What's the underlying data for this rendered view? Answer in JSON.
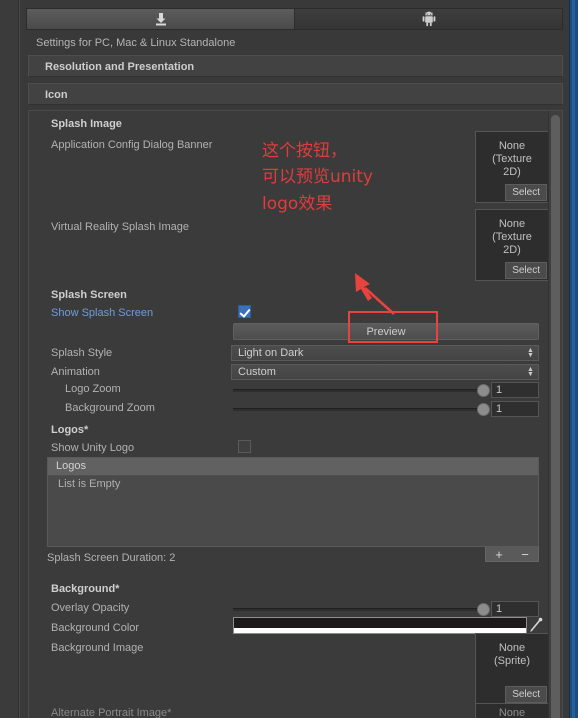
{
  "window": {
    "accent_color": "#2a6099",
    "background_color": "#393939"
  },
  "tabs": [
    {
      "name": "standalone",
      "icon": "standalone-download-icon",
      "active": true
    },
    {
      "name": "android",
      "icon": "android-robot-icon",
      "active": false
    }
  ],
  "header": {
    "settings_label": "Settings for PC, Mac & Linux Standalone"
  },
  "foldouts": [
    {
      "label": "Resolution and Presentation"
    },
    {
      "label": "Icon"
    }
  ],
  "splash_image": {
    "title": "Splash Image",
    "fields": [
      {
        "label": "Application Config Dialog Banner",
        "value_line1": "None",
        "value_line2": "(Texture",
        "value_line3": "2D)",
        "select_label": "Select"
      },
      {
        "label": "Virtual Reality Splash Image",
        "value_line1": "None",
        "value_line2": "(Texture",
        "value_line3": "2D)",
        "select_label": "Select"
      }
    ]
  },
  "splash_screen": {
    "title": "Splash Screen",
    "show_splash_screen_label": "Show Splash Screen",
    "show_splash_screen_checked": true,
    "preview_button_label": "Preview",
    "splash_style_label": "Splash Style",
    "splash_style_value": "Light on Dark",
    "animation_label": "Animation",
    "animation_value": "Custom",
    "logo_zoom_label": "Logo Zoom",
    "logo_zoom_value": "1",
    "background_zoom_label": "Background Zoom",
    "background_zoom_value": "1"
  },
  "logos": {
    "title": "Logos*",
    "show_unity_logo_label": "Show Unity Logo",
    "show_unity_logo_checked": false,
    "list_header": "Logos",
    "list_empty_text": "List is Empty",
    "add_button": "+",
    "remove_button": "−",
    "duration_text": "Splash Screen Duration: 2"
  },
  "background": {
    "title": "Background*",
    "overlay_opacity_label": "Overlay Opacity",
    "overlay_opacity_value": "1",
    "background_color_label": "Background Color",
    "background_color_value": "#1C1A1A",
    "background_image_label": "Background Image",
    "background_image_line1": "None",
    "background_image_line2": "(Sprite)",
    "background_image_select": "Select",
    "alternate_portrait_label": "Alternate Portrait Image*",
    "alternate_portrait_value": "None"
  },
  "annotations": {
    "note_line1": "这个按钮，",
    "note_line2": "可以预览unity",
    "note_line3": "logo效果",
    "color": "#E03C3C"
  }
}
